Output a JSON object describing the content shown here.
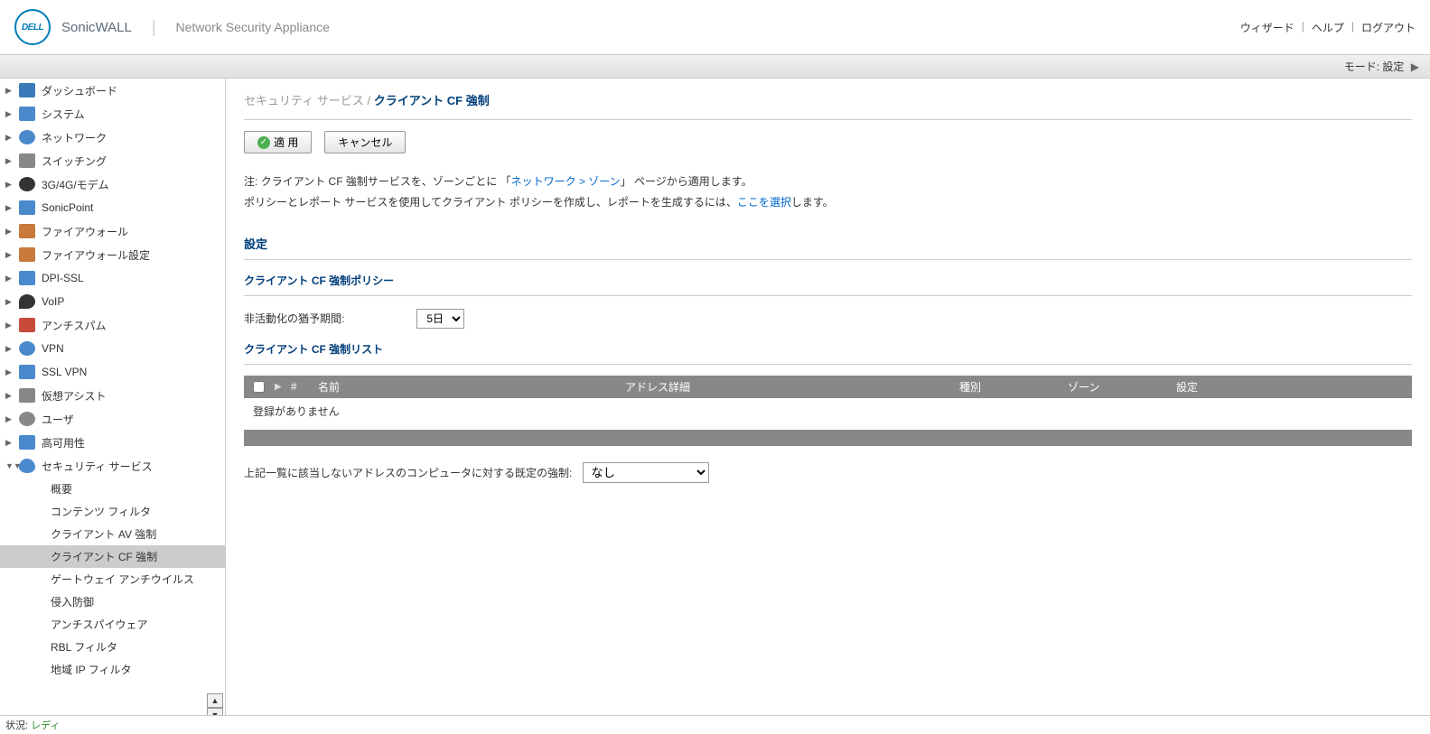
{
  "header": {
    "logo_text": "DELL",
    "brand": "SonicWALL",
    "subtitle": "Network Security Appliance",
    "links": {
      "wizard": "ウィザード",
      "help": "ヘルプ",
      "logout": "ログアウト"
    }
  },
  "mode_bar": {
    "label": "モード:",
    "value": "設定"
  },
  "sidebar": {
    "items": [
      {
        "label": "ダッシュボード"
      },
      {
        "label": "システム"
      },
      {
        "label": "ネットワーク"
      },
      {
        "label": "スイッチング"
      },
      {
        "label": "3G/4G/モデム"
      },
      {
        "label": "SonicPoint"
      },
      {
        "label": "ファイアウォール"
      },
      {
        "label": "ファイアウォール設定"
      },
      {
        "label": "DPI-SSL"
      },
      {
        "label": "VoIP"
      },
      {
        "label": "アンチスパム"
      },
      {
        "label": "VPN"
      },
      {
        "label": "SSL VPN"
      },
      {
        "label": "仮想アシスト"
      },
      {
        "label": "ユーザ"
      },
      {
        "label": "高可用性"
      },
      {
        "label": "セキュリティ サービス"
      }
    ],
    "subitems": [
      {
        "label": "概要"
      },
      {
        "label": "コンテンツ フィルタ"
      },
      {
        "label": "クライアント AV 強制"
      },
      {
        "label": "クライアント CF 強制"
      },
      {
        "label": "ゲートウェイ アンチウイルス"
      },
      {
        "label": "侵入防御"
      },
      {
        "label": "アンチスパイウェア"
      },
      {
        "label": "RBL フィルタ"
      },
      {
        "label": "地域 IP フィルタ"
      }
    ]
  },
  "breadcrumb": {
    "parent": "セキュリティ サービス /",
    "current": "クライアント CF 強制"
  },
  "actions": {
    "apply": "適 用",
    "cancel": "キャンセル"
  },
  "notes": {
    "prefix": "注:",
    "line1a": "クライアント CF 強制サービスを、ゾーンごとに 「",
    "line1_link": "ネットワーク > ゾーン",
    "line1b": "」 ページから適用します。",
    "line2a": "ポリシーとレポート サービスを使用してクライアント ポリシーを作成し、レポートを生成するには、",
    "line2_link": "ここを選択",
    "line2b": "します。"
  },
  "settings": {
    "title": "設定",
    "policy_title": "クライアント CF 強制ポリシー",
    "grace_label": "非活動化の猶予期間:",
    "grace_value": "5日",
    "list_title": "クライアント CF 強制リスト",
    "columns": {
      "num": "#",
      "name": "名前",
      "addr": "アドレス詳細",
      "type": "種別",
      "zone": "ゾーン",
      "config": "設定"
    },
    "empty": "登録がありません",
    "default_enforce_label": "上記一覧に該当しないアドレスのコンピュータに対する既定の強制:",
    "default_enforce_value": "なし"
  },
  "status": {
    "label": "状況:",
    "value": "レディ"
  }
}
